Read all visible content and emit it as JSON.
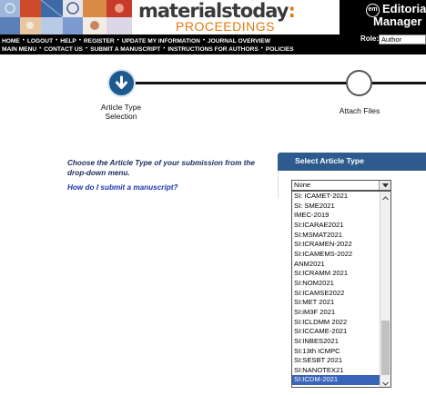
{
  "header": {
    "brand_line1": "materialstoday",
    "brand_colon": ":",
    "brand_line2": "PROCEEDINGS",
    "em_logo": "em",
    "em_line1": "Editorial",
    "em_line2": "Manager"
  },
  "nav": {
    "row1": [
      "HOME",
      "LOGOUT",
      "HELP",
      "REGISTER",
      "UPDATE MY INFORMATION",
      "JOURNAL OVERVIEW"
    ],
    "row2": [
      "MAIN MENU",
      "CONTACT US",
      "SUBMIT A MANUSCRIPT",
      "INSTRUCTIONS FOR AUTHORS",
      "POLICIES"
    ],
    "separator": "•",
    "role_label": "Role:",
    "role_value": "Author"
  },
  "steps": [
    {
      "label": "Article Type Selection",
      "active": true,
      "icon": "arrow-down-icon"
    },
    {
      "label": "Attach Files",
      "active": false
    }
  ],
  "main": {
    "instructions": "Choose the Article Type of your submission from the drop-down menu.",
    "help_link": "How do I submit a manuscript?",
    "panel_title": "Select Article Type",
    "select_value": "None"
  },
  "dropdown": {
    "options": [
      "SI: ICAMET-2021",
      "SI: SME2021",
      "IMEC-2019",
      "SI:ICARAE2021",
      "SI:MSMAT2021",
      "SI:ICRAMEN-2022",
      "SI:ICAMEMS-2022",
      "ANM2021",
      "SI:ICRAMM 2021",
      "SI:NOM2021",
      "SI:ICAMSE2022",
      "SI:MET 2021",
      "SI:iM3F 2021",
      "SI:ICLDMM 2022",
      "SI:ICCAME-2021",
      "SI:INBES2021",
      "SI:13th ICMPC",
      "SI:SESBT 2021",
      "SI:NANOTEX21",
      "SI:ICDM-2021"
    ],
    "selected_index": 19
  },
  "colors": {
    "step_active": "#1e5a8e",
    "panel_header": "#2e5b8d",
    "selected_option": "#3a64b8",
    "brand_orange": "#e07a10"
  }
}
